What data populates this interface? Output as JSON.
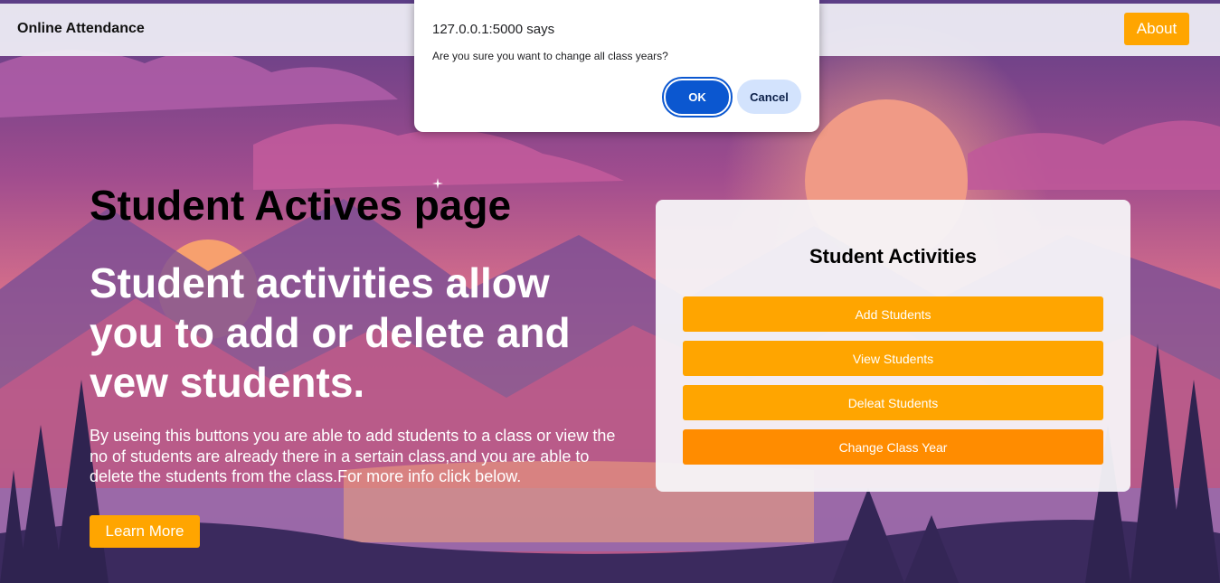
{
  "navbar": {
    "brand": "Online Attendance",
    "about_label": "About"
  },
  "hero": {
    "title": "Student Actives page",
    "subtitle": "Student activities allow you to add or delete and vew students.",
    "description": "By useing this buttons you are able to add students to a class or view the no of students are already there in a sertain class,and you are able to delete the students from the class.For more info click below.",
    "learn_more_label": "Learn More"
  },
  "card": {
    "title": "Student Activities",
    "buttons": [
      {
        "label": "Add Students"
      },
      {
        "label": "View Students"
      },
      {
        "label": "Deleat Students"
      },
      {
        "label": "Change Class Year"
      }
    ]
  },
  "dialog": {
    "title": "127.0.0.1:5000 says",
    "message": "Are you sure you want to change all class years?",
    "ok_label": "OK",
    "cancel_label": "Cancel"
  },
  "colors": {
    "accent": "#ffa500",
    "accent_hover": "#ff8c00",
    "dialog_primary": "#0b57d0",
    "dialog_secondary": "#d3e3fd"
  }
}
